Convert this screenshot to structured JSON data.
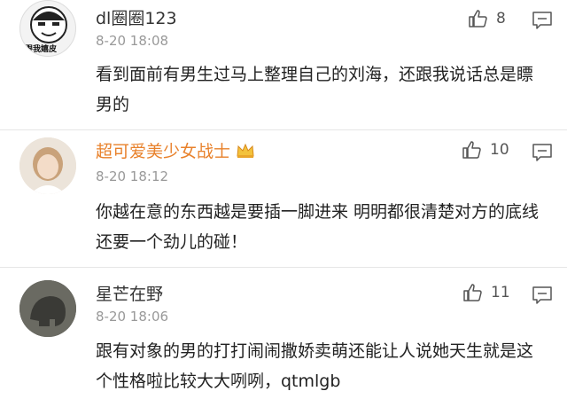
{
  "comments": [
    {
      "username": "dl圈圈123",
      "avatar_caption": "跟我嬉皮",
      "time": "8-20 18:08",
      "text": "看到面前有男生过马上整理自己的刘海，还跟我说话总是瞟男的",
      "likes": "8"
    },
    {
      "username": "超可爱美少女战士",
      "time": "8-20 18:12",
      "text": "你越在意的东西越是要插一脚进来 明明都很清楚对方的底线还要一个劲儿的碰！",
      "likes": "10"
    },
    {
      "username": "星芒在野",
      "time": "8-20 18:06",
      "text": "跟有对象的男的打打闹闹撒娇卖萌还能让人说她天生就是这个性格啦比较大大咧咧，qtmlgb",
      "likes": "11"
    }
  ],
  "icons": {
    "like": "thumbs-up-icon",
    "reply": "comment-icon",
    "badge": "crown-icon"
  },
  "colors": {
    "vip_name": "#e8812b",
    "meta_gray": "#999999"
  }
}
